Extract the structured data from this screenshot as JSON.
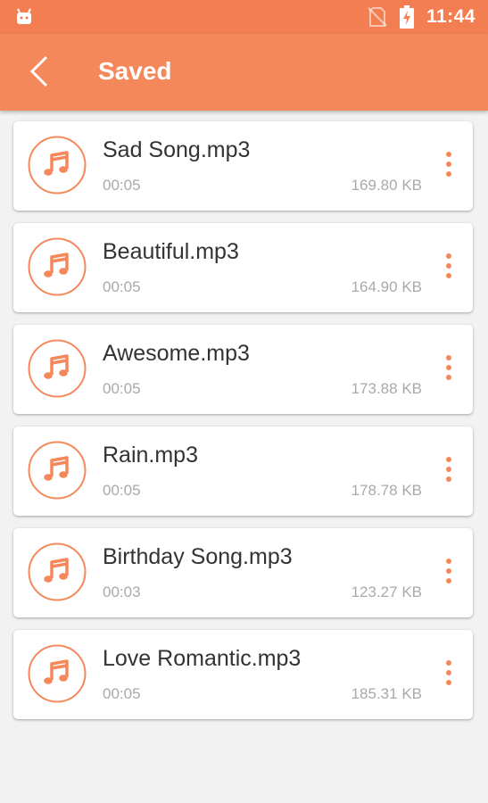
{
  "status_bar": {
    "time": "11:44",
    "left_icon": "android-icon",
    "icons": [
      "no-sim-icon",
      "battery-charging-icon"
    ]
  },
  "app_bar": {
    "title": "Saved",
    "back_icon": "back-arrow-icon"
  },
  "colors": {
    "accent": "#f5885a",
    "status_bar": "#f27e52",
    "background": "#f2f2f2",
    "secondary_text": "#a9a9a9"
  },
  "files": [
    {
      "name": "Sad Song.mp3",
      "duration": "00:05",
      "size": "169.80 KB"
    },
    {
      "name": "Beautiful.mp3",
      "duration": "00:05",
      "size": "164.90 KB"
    },
    {
      "name": "Awesome.mp3",
      "duration": "00:05",
      "size": "173.88 KB"
    },
    {
      "name": "Rain.mp3",
      "duration": "00:05",
      "size": "178.78 KB"
    },
    {
      "name": "Birthday Song.mp3",
      "duration": "00:03",
      "size": "123.27 KB"
    },
    {
      "name": "Love Romantic.mp3",
      "duration": "00:05",
      "size": "185.31 KB"
    }
  ]
}
